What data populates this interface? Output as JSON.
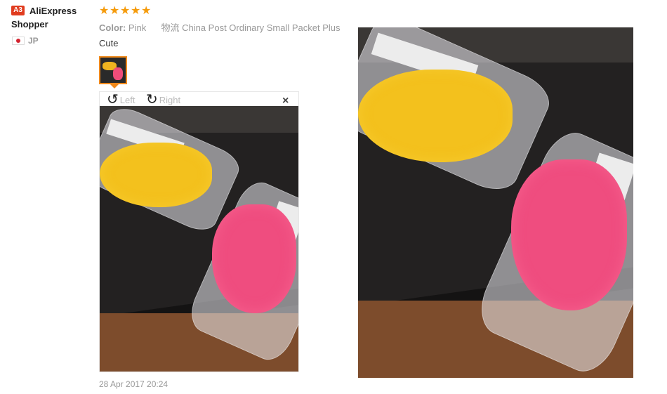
{
  "reviewer": {
    "badge": "A3",
    "name": "AliExpress Shopper",
    "country": "JP",
    "flag_color": "#d3232f"
  },
  "review": {
    "stars": 5,
    "star_glyphs": [
      "★",
      "★",
      "★",
      "★",
      "★"
    ],
    "star_color": "#f59b0b",
    "color_label": "Color:",
    "color_value": "Pink",
    "logistics_label": "物流",
    "logistics_value": "China Post Ordinary Small Packet Plus",
    "text": "Cute",
    "date": "28 Apr 2017 20:24"
  },
  "viewer": {
    "rotate_left_icon": "rotate-left-icon",
    "rotate_left_glyph": "↺",
    "rotate_left_label": "Left",
    "rotate_right_icon": "rotate-right-icon",
    "rotate_right_glyph": "↻",
    "rotate_right_label": "Right",
    "close_glyph": "×",
    "accent_color": "#f0891b"
  }
}
